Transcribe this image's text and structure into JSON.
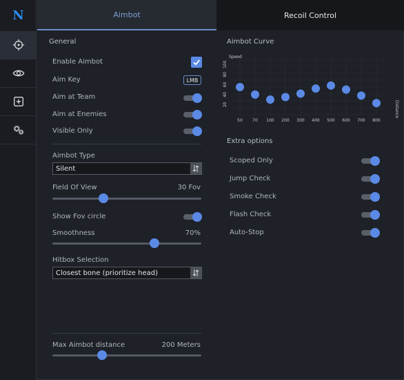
{
  "sidebar": {
    "logo": "N",
    "items": [
      {
        "icon": "crosshair-icon",
        "active": true
      },
      {
        "icon": "eye-icon",
        "active": false
      },
      {
        "icon": "plus-square-icon",
        "active": false
      },
      {
        "icon": "gears-icon",
        "active": false
      }
    ]
  },
  "tabs": [
    {
      "label": "Aimbot",
      "active": true
    },
    {
      "label": "Recoil Control",
      "active": false
    }
  ],
  "general": {
    "title": "General",
    "enable_aimbot": {
      "label": "Enable Aimbot",
      "checked": true
    },
    "aim_key": {
      "label": "Aim Key",
      "value": "LMB"
    },
    "aim_at_team": {
      "label": "Aim at Team",
      "on": true
    },
    "aim_at_enemies": {
      "label": "Aim at Enemies",
      "on": true
    },
    "visible_only": {
      "label": "Visible Only",
      "on": true
    },
    "aimbot_type": {
      "label": "Aimbot Type",
      "value": "Silent"
    },
    "field_of_view": {
      "label": "Field Of View",
      "value": "30 Fov",
      "fraction": 0.33
    },
    "show_fov_circle": {
      "label": "Show Fov circle",
      "on": true
    },
    "smoothness": {
      "label": "Smoothness",
      "value": "70%",
      "fraction": 0.7
    },
    "hitbox_selection": {
      "label": "Hitbox Selection",
      "value": "Closest bone (prioritize head)"
    },
    "max_distance": {
      "label": "Max Aimbot distance",
      "value": "200 Meters",
      "fraction": 0.32
    }
  },
  "curve": {
    "title": "Aimbot Curve"
  },
  "chart_data": {
    "type": "scatter",
    "ylabel": "Speed",
    "xlabel": "Distance",
    "categories": [
      "50",
      "70",
      "100",
      "200",
      "300",
      "400",
      "500",
      "600",
      "700",
      "800"
    ],
    "values": [
      55,
      40,
      30,
      35,
      42,
      52,
      58,
      50,
      38,
      23
    ],
    "yticks": [
      "20",
      "40",
      "60",
      "80",
      "100"
    ],
    "ylim": [
      0,
      110
    ],
    "grid": true
  },
  "extra": {
    "title": "Extra options",
    "items": [
      {
        "label": "Scoped Only",
        "on": true
      },
      {
        "label": "Jump Check",
        "on": true
      },
      {
        "label": "Smoke Check",
        "on": true
      },
      {
        "label": "Flash Check",
        "on": true
      },
      {
        "label": "Auto-Stop",
        "on": true
      }
    ]
  },
  "colors": {
    "accent": "#5b8ae6",
    "logo": "#2b8cf0",
    "background": "#1e2127"
  }
}
